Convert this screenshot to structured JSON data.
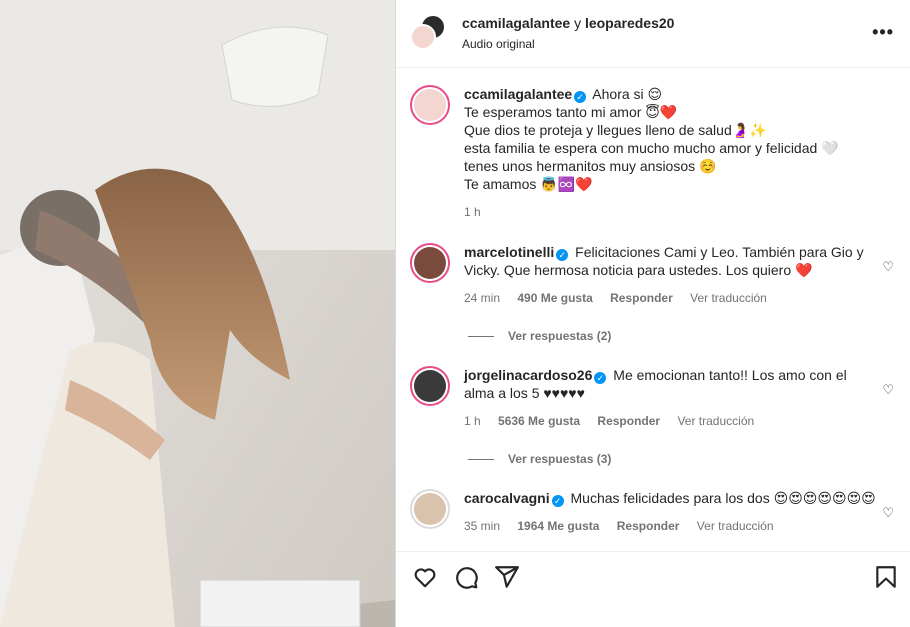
{
  "header": {
    "user1": "ccamilagalantee",
    "joiner": "y",
    "user2": "leoparedes20",
    "audio": "Audio original",
    "more_icon": "more-icon"
  },
  "caption": {
    "username": "ccamilagalantee",
    "lines": [
      "Ahora si 😌",
      "Te esperamos tanto mi amor 😇❤️",
      "Que dios te proteja y llegues lleno de salud🤰✨",
      "esta familia te espera con mucho mucho amor y felicidad 🤍 tenes unos hermanitos muy ansiosos ☺️",
      "Te amamos 👼♾️❤️"
    ],
    "time": "1 h"
  },
  "comments": [
    {
      "username": "marcelotinelli",
      "text": "Felicitaciones Cami y Leo. También para Gio y Vicky. Que hermosa noticia para ustedes. Los quiero ❤️",
      "time": "24 min",
      "likes": "490 Me gusta",
      "reply": "Responder",
      "translate": "Ver traducción",
      "replies": "Ver respuestas (2)"
    },
    {
      "username": "jorgelinacardoso26",
      "text": "Me emocionan tanto!! Los amo con el alma a los 5 ♥♥♥♥♥",
      "time": "1 h",
      "likes": "5636 Me gusta",
      "reply": "Responder",
      "translate": "Ver traducción",
      "replies": "Ver respuestas (3)"
    },
    {
      "username": "carocalvagni",
      "text": "Muchas felicidades para los dos 😍😍😍😍😍😍😍",
      "time": "35 min",
      "likes": "1964 Me gusta",
      "reply": "Responder",
      "translate": "Ver traducción"
    }
  ],
  "actions": {
    "like_icon": "heart-icon",
    "comment_icon": "comment-icon",
    "share_icon": "share-icon",
    "save_icon": "bookmark-icon"
  },
  "colors": {
    "accent": "#0095f6",
    "ring": "#e94b8a",
    "text": "#262626",
    "muted": "#737373"
  }
}
